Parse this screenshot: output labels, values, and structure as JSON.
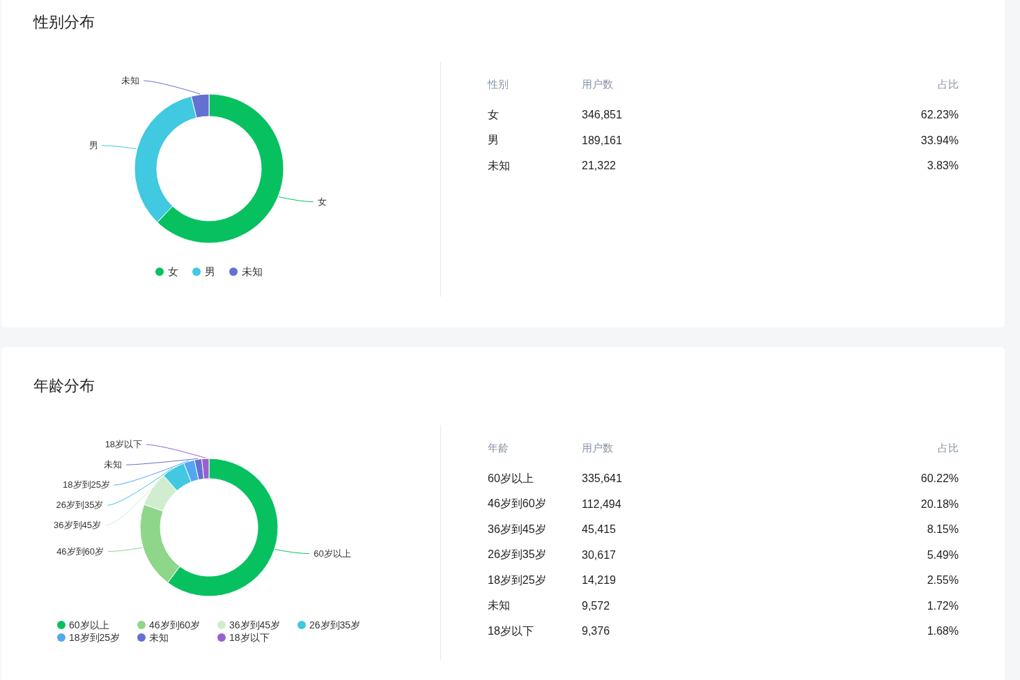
{
  "sections": [
    {
      "title": "性别分布",
      "chart_data": {
        "type": "donut",
        "categories": [
          "女",
          "男",
          "未知"
        ],
        "values": [
          62.23,
          33.94,
          3.83
        ]
      },
      "legend": [
        {
          "label": "女",
          "color": "#07c160"
        },
        {
          "label": "男",
          "color": "#40c9e0"
        },
        {
          "label": "未知",
          "color": "#6470d2"
        }
      ],
      "table": {
        "columns": [
          "性别",
          "用户数",
          "占比"
        ],
        "rows": [
          [
            "女",
            "346,851",
            "62.23%"
          ],
          [
            "男",
            "189,161",
            "33.94%"
          ],
          [
            "未知",
            "21,322",
            "3.83%"
          ]
        ]
      }
    },
    {
      "title": "年龄分布",
      "chart_data": {
        "type": "donut",
        "categories": [
          "60岁以上",
          "46岁到60岁",
          "36岁到45岁",
          "26岁到35岁",
          "18岁到25岁",
          "未知",
          "18岁以下"
        ],
        "values": [
          60.22,
          20.18,
          8.15,
          5.49,
          2.55,
          1.72,
          1.68
        ]
      },
      "legend": [
        {
          "label": "60岁以上",
          "color": "#07c160"
        },
        {
          "label": "46岁到60岁",
          "color": "#8ed68a"
        },
        {
          "label": "36岁到45岁",
          "color": "#d0eecf"
        },
        {
          "label": "26岁到35岁",
          "color": "#40c9e0"
        },
        {
          "label": "18岁到25岁",
          "color": "#52a8f0"
        },
        {
          "label": "未知",
          "color": "#6470d2"
        },
        {
          "label": "18岁以下",
          "color": "#9a5fd0"
        }
      ],
      "table": {
        "columns": [
          "年龄",
          "用户数",
          "占比"
        ],
        "rows": [
          [
            "60岁以上",
            "335,641",
            "60.22%"
          ],
          [
            "46岁到60岁",
            "112,494",
            "20.18%"
          ],
          [
            "36岁到45岁",
            "45,415",
            "8.15%"
          ],
          [
            "26岁到35岁",
            "30,617",
            "5.49%"
          ],
          [
            "18岁到25岁",
            "14,219",
            "2.55%"
          ],
          [
            "未知",
            "9,572",
            "1.72%"
          ],
          [
            "18岁以下",
            "9,376",
            "1.68%"
          ]
        ]
      }
    }
  ]
}
